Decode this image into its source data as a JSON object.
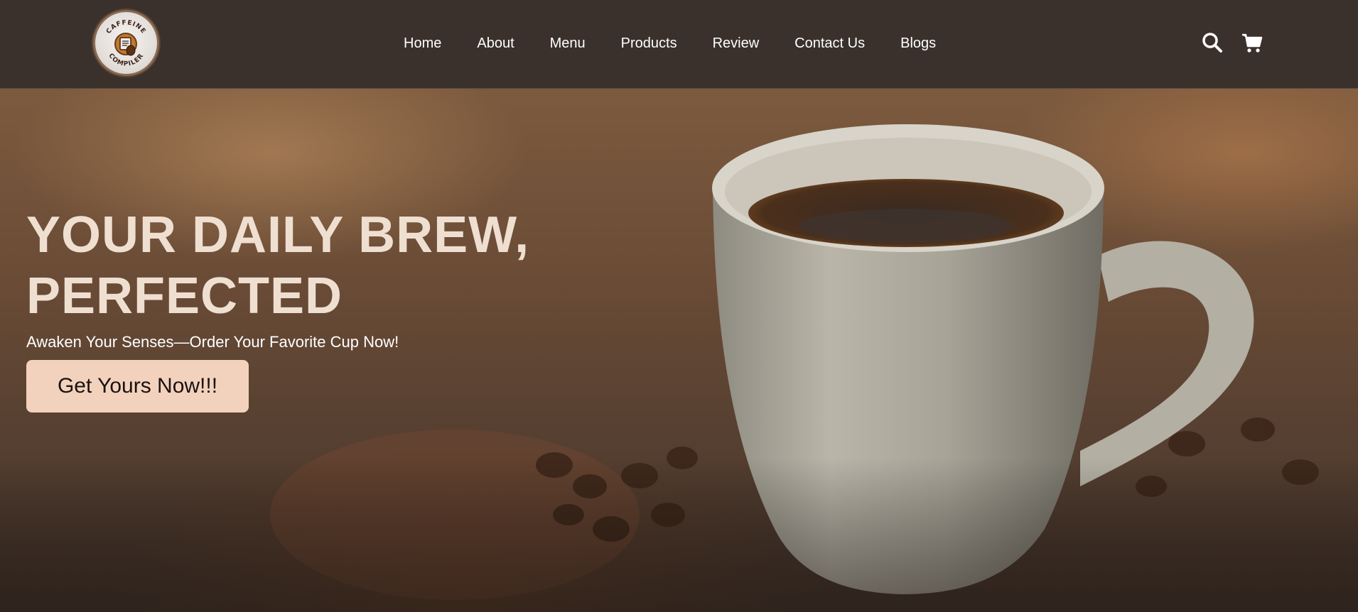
{
  "brand": {
    "logo_top_text": "CAFFEINE",
    "logo_bottom_text": "COMPILER"
  },
  "nav": {
    "links": [
      "Home",
      "About",
      "Menu",
      "Products",
      "Review",
      "Contact Us",
      "Blogs"
    ],
    "icons": [
      "search-icon",
      "cart-icon"
    ]
  },
  "hero": {
    "title_line1": "YOUR DAILY BREW,",
    "title_line2": "PERFECTED",
    "subtitle": "Awaken Your Senses—Order Your Favorite Cup Now!",
    "cta_label": "Get Yours Now!!!"
  },
  "colors": {
    "navbar_bg": "#3a312c",
    "title_text": "#efdfd1",
    "cta_bg": "#f3d2bd",
    "cta_text": "#1a1210"
  }
}
